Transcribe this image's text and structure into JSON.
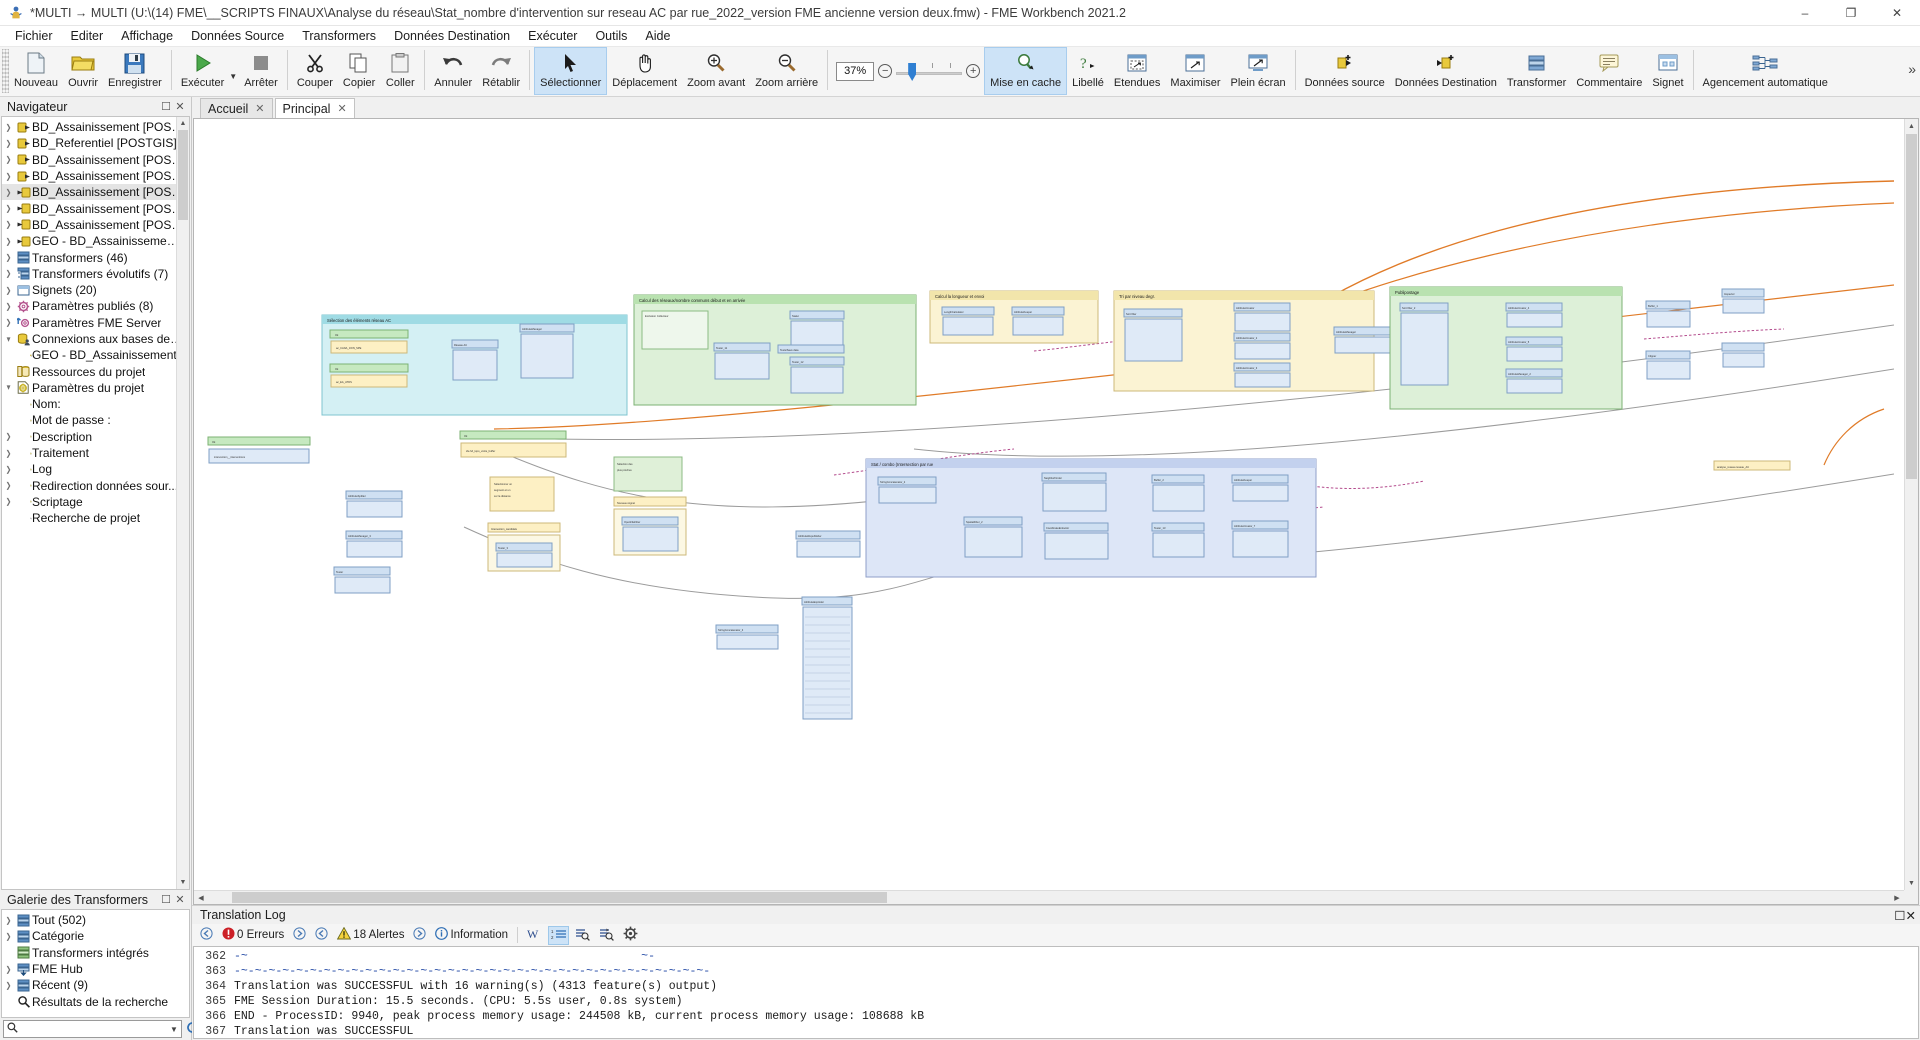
{
  "window": {
    "title": "*MULTI → MULTI (U:\\(14) FME\\__SCRIPTS FINAUX\\Analyse du réseau\\Stat_nombre d'intervention sur reseau AC par rue_2022_version FME ancienne version deux.fmw) - FME Workbench 2021.2",
    "app_icon": "fme-logo-icon",
    "minimize": "–",
    "maximize": "❐",
    "close": "✕"
  },
  "menu": {
    "items": [
      "Fichier",
      "Editer",
      "Affichage",
      "Données Source",
      "Transformers",
      "Données Destination",
      "Exécuter",
      "Outils",
      "Aide"
    ]
  },
  "toolbar": {
    "buttons": [
      {
        "label": "Nouveau",
        "icon": "new-document-icon"
      },
      {
        "label": "Ouvrir",
        "icon": "open-folder-icon"
      },
      {
        "label": "Enregistrer",
        "icon": "save-floppy-icon"
      },
      {
        "label": "Exécuter",
        "icon": "run-play-icon"
      },
      {
        "label": "Arrêter",
        "icon": "stop-square-icon"
      },
      {
        "label": "Couper",
        "icon": "scissors-icon"
      },
      {
        "label": "Copier",
        "icon": "copy-icon"
      },
      {
        "label": "Coller",
        "icon": "clipboard-paste-icon"
      },
      {
        "label": "Annuler",
        "icon": "undo-arrow-icon"
      },
      {
        "label": "Rétablir",
        "icon": "redo-arrow-icon"
      },
      {
        "label": "Sélectionner",
        "icon": "cursor-arrow-icon",
        "active": true
      },
      {
        "label": "Déplacement",
        "icon": "hand-pan-icon"
      },
      {
        "label": "Zoom avant",
        "icon": "zoom-in-icon"
      },
      {
        "label": "Zoom arrière",
        "icon": "zoom-out-icon"
      },
      {
        "label": "Mise en cache",
        "icon": "cache-magnifier-icon",
        "active": true
      },
      {
        "label": "Libellé",
        "icon": "label-question-icon"
      },
      {
        "label": "Etendues",
        "icon": "extents-icon"
      },
      {
        "label": "Maximiser",
        "icon": "maximize-icon"
      },
      {
        "label": "Plein écran",
        "icon": "fullscreen-icon"
      },
      {
        "label": "Données source",
        "icon": "add-source-icon"
      },
      {
        "label": "Données Destination",
        "icon": "add-destination-icon"
      },
      {
        "label": "Transformer",
        "icon": "add-transformer-icon"
      },
      {
        "label": "Commentaire",
        "icon": "annotation-icon"
      },
      {
        "label": "Signet",
        "icon": "bookmark-icon"
      },
      {
        "label": "Agencement automatique",
        "icon": "auto-layout-icon"
      }
    ],
    "zoom": {
      "value": "37%",
      "minus": "−",
      "plus": "+"
    },
    "overflow_chevron": "»"
  },
  "navigator": {
    "title": "Navigateur",
    "float_icon": "undock-icon",
    "close_icon": "close-icon",
    "items": [
      {
        "label": "BD_Assainissement [POSTGIS...",
        "icon": "reader-icon",
        "chev": "closed",
        "indent": 0
      },
      {
        "label": "BD_Referentiel [POSTGIS]",
        "icon": "reader-icon",
        "chev": "closed",
        "indent": 0
      },
      {
        "label": "BD_Assainissement [POSTGR...",
        "icon": "reader-icon",
        "chev": "closed",
        "indent": 0
      },
      {
        "label": "BD_Assainissement [POSTGIS...",
        "icon": "reader-icon",
        "chev": "closed",
        "indent": 0
      },
      {
        "label": "BD_Assainissement [POSTGIS...",
        "icon": "writer-icon",
        "chev": "closed",
        "indent": 0,
        "selected": true
      },
      {
        "label": "BD_Assainissement [POSTGIS...",
        "icon": "writer-icon",
        "chev": "closed",
        "indent": 0
      },
      {
        "label": "BD_Assainissement [POSTGR...",
        "icon": "writer-icon",
        "chev": "closed",
        "indent": 0
      },
      {
        "label": "GEO - BD_Assainissement [P...",
        "icon": "writer-icon",
        "chev": "closed",
        "indent": 0
      },
      {
        "label": "Transformers (46)",
        "icon": "transformers-icon",
        "chev": "closed",
        "indent": 0
      },
      {
        "label": "Transformers évolutifs (7)",
        "icon": "custom-transformers-icon",
        "chev": "closed",
        "indent": 0
      },
      {
        "label": "Signets (20)",
        "icon": "bookmark-list-icon",
        "chev": "closed",
        "indent": 0
      },
      {
        "label": "Paramètres publiés (8)",
        "icon": "gear-pink-icon",
        "chev": "closed",
        "indent": 0
      },
      {
        "label": "Paramètres FME Server",
        "icon": "gear-server-icon",
        "chev": "closed",
        "indent": 0
      },
      {
        "label": "Connexions aux bases de do...",
        "icon": "database-user-icon",
        "chev": "open",
        "indent": 0
      },
      {
        "label": "GEO - BD_Assainissement",
        "icon": "database-user-icon",
        "chev": "none",
        "indent": 1
      },
      {
        "label": "Ressources du projet",
        "icon": "resources-icon",
        "chev": "none",
        "indent": 0
      },
      {
        "label": "Paramètres du projet",
        "icon": "gear-doc-icon",
        "chev": "open",
        "indent": 0
      },
      {
        "label": "Nom: <Non défini>",
        "icon": "gear-doc-icon",
        "chev": "none",
        "indent": 1
      },
      {
        "label": "Mot de passe : <Non défi...",
        "icon": "gear-doc-icon",
        "chev": "none",
        "indent": 1
      },
      {
        "label": "Description",
        "icon": "gear-doc-icon",
        "chev": "closed",
        "indent": 1
      },
      {
        "label": "Traitement",
        "icon": "gear-doc-icon",
        "chev": "closed",
        "indent": 1
      },
      {
        "label": "Log",
        "icon": "gear-doc-icon",
        "chev": "closed",
        "indent": 1
      },
      {
        "label": "Redirection données sour...",
        "icon": "gear-doc-icon",
        "chev": "closed",
        "indent": 1
      },
      {
        "label": "Scriptage",
        "icon": "gear-doc-icon",
        "chev": "closed",
        "indent": 1
      },
      {
        "label": "Recherche de projet",
        "icon": "search-icon",
        "chev": "none",
        "indent": 1
      }
    ]
  },
  "gallery": {
    "title": "Galerie des Transformers",
    "float_icon": "undock-icon",
    "close_icon": "close-icon",
    "items": [
      {
        "label": "Tout (502)",
        "icon": "transformers-icon",
        "chev": "closed"
      },
      {
        "label": "Catégorie",
        "icon": "transformers-icon",
        "chev": "closed"
      },
      {
        "label": "Transformers intégrés",
        "icon": "transformers-green-icon",
        "chev": "none"
      },
      {
        "label": "FME Hub",
        "icon": "fme-hub-icon",
        "chev": "closed"
      },
      {
        "label": "Récent (9)",
        "icon": "transformers-icon",
        "chev": "closed"
      },
      {
        "label": "Résultats de la recherche",
        "icon": "search-icon",
        "chev": "none"
      }
    ],
    "search": {
      "value": "",
      "placeholder": "",
      "icon": "search-icon",
      "dropdown": "▾",
      "refresh_icon": "refresh-icon"
    }
  },
  "tabs": [
    {
      "label": "Accueil",
      "close": "✕",
      "active": false
    },
    {
      "label": "Principal",
      "close": "✕",
      "active": true
    }
  ],
  "canvas": {
    "bookmarks": [
      {
        "label": "Sélection des éléments réseau AC",
        "color": "#bfe9ef"
      },
      {
        "label": "Calcul des réseaux/nombre communs début et en arrivée",
        "color": "#cfe9cc"
      },
      {
        "label": "Calcul la longueur et envoi",
        "color": "#f6edc4"
      },
      {
        "label": "Tri par niveau dégr.",
        "color": "#f6edc4"
      },
      {
        "label": "Publipostage",
        "color": "#cfe9cc"
      },
      {
        "label": "Stat / combo (Intersection par rue",
        "color": "#cfd9f2"
      }
    ],
    "nodes": [
      "GeometryFilter",
      "AttributeCreator",
      "AttributeManager",
      "Sampler",
      "Counter",
      "StringConcatenator",
      "LengthCalculator",
      "AttributeKeeper",
      "Tester",
      "FeatureMerger",
      "Joiner",
      "Buffer_1",
      "Buffer_2",
      "SpatialRelator",
      "NeighborFinder",
      "Aggregator",
      "StatisticsCalculator",
      "ListBuilder",
      "AttributeExploder",
      "Clipper",
      "AreaCalculator"
    ]
  },
  "log": {
    "title": "Translation Log",
    "float_icon": "undock-icon",
    "close_icon": "close-icon",
    "toolbar": {
      "prev_error": "←",
      "errors_label": "0 Erreurs",
      "errors_icon": "error-circle-icon",
      "next_error": "→",
      "prev_warning": "←",
      "warnings_label": "18 Alertes",
      "warnings_icon": "warning-triangle-icon",
      "next_warning": "→",
      "information_label": "Information",
      "information_icon": "info-circle-icon",
      "word_wrap_icon": "word-wrap-icon",
      "line_numbers_icon": "line-numbers-icon",
      "find_icon": "find-icon",
      "find_next_icon": "find-next-icon",
      "settings_icon": "gear-icon"
    },
    "lines": [
      {
        "num": "362",
        "text": "-~                                                         ~-",
        "blue": true
      },
      {
        "num": "363",
        "text": "-~-~-~-~-~-~-~-~-~-~-~-~-~-~-~-~-~-~-~-~-~-~-~-~-~-~-~-~-~-~-~-~-~-~-",
        "blue": true
      },
      {
        "num": "364",
        "text": "Translation was SUCCESSFUL with 16 warning(s) (4313 feature(s) output)",
        "blue": false
      },
      {
        "num": "365",
        "text": "FME Session Duration: 15.5 seconds. (CPU: 5.5s user, 0.8s system)",
        "blue": false
      },
      {
        "num": "366",
        "text": "END - ProcessID: 9940, peak process memory usage: 244508 kB, current process memory usage: 108688 kB",
        "blue": false
      },
      {
        "num": "367",
        "text": "Translation was SUCCESSFUL",
        "blue": false
      }
    ]
  },
  "colors": {
    "accent": "#2f7fd2",
    "selection": "#cde3f7",
    "error": "#cc2027",
    "warning": "#f0c419",
    "panel_bg": "#f0f0f0"
  }
}
